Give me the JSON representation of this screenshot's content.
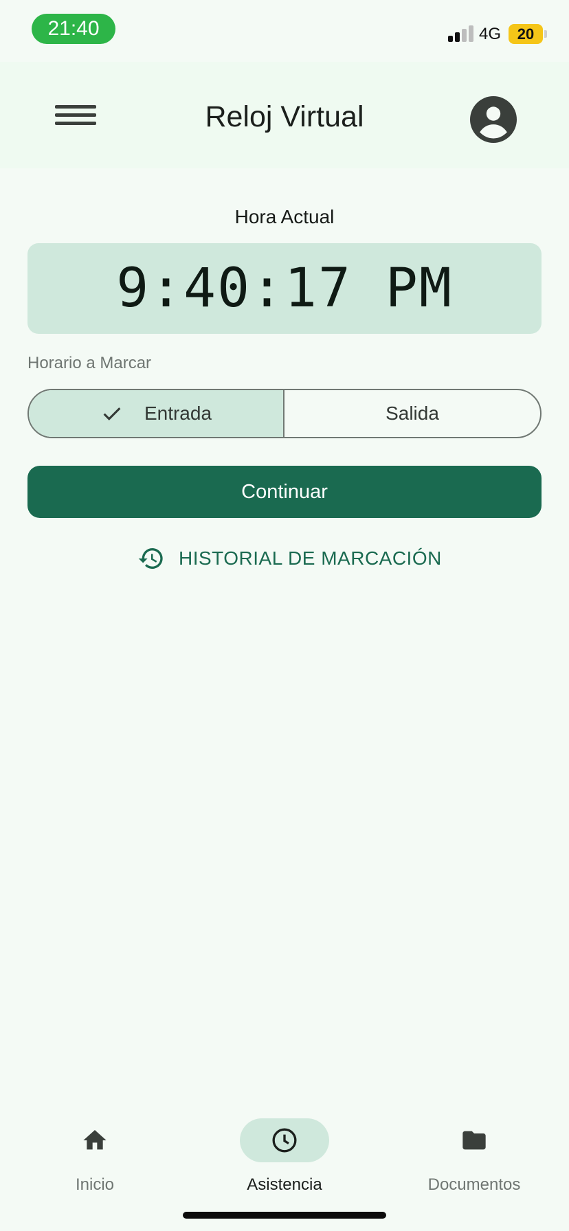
{
  "status_bar": {
    "time": "21:40",
    "network": "4G",
    "battery": "20",
    "colors": {
      "time_pill": "#2db548",
      "battery": "#f5c518"
    }
  },
  "app_bar": {
    "title": "Reloj Virtual",
    "menu_icon": "hamburger-menu-icon",
    "profile_icon": "account-circle-icon"
  },
  "clock": {
    "label": "Hora Actual",
    "value": "9:40:17 PM"
  },
  "schedule": {
    "label": "Horario a Marcar",
    "options": [
      {
        "label": "Entrada",
        "selected": true
      },
      {
        "label": "Salida",
        "selected": false
      }
    ]
  },
  "actions": {
    "continue_label": "Continuar",
    "history_label": "HISTORIAL DE MARCACIÓN",
    "history_icon": "history-icon"
  },
  "bottom_nav": {
    "items": [
      {
        "label": "Inicio",
        "icon": "home-icon",
        "active": false
      },
      {
        "label": "Asistencia",
        "icon": "clock-icon",
        "active": true
      },
      {
        "label": "Documentos",
        "icon": "folder-icon",
        "active": false
      }
    ]
  },
  "theme": {
    "primary": "#1a6a50",
    "secondary_container": "#cfe8dc",
    "background": "#f4faf5"
  }
}
